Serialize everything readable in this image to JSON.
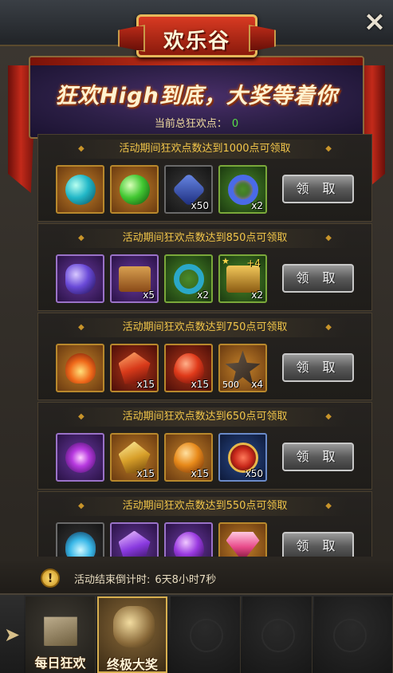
{
  "header": {
    "title": "欢乐谷",
    "close_icon": "×"
  },
  "banner": {
    "slogan": "狂欢High到底，大奖等着你",
    "points_label": "当前总狂欢点：",
    "points_value": "0"
  },
  "tiers": [
    {
      "requirement": "活动期间狂欢点数达到1000点可领取",
      "claim_label": "领 取",
      "rewards": [
        {
          "icon": "teal-orb-icon",
          "qty": ""
        },
        {
          "icon": "green-orb-icon",
          "qty": ""
        },
        {
          "icon": "sapphire-icon",
          "qty": "x50"
        },
        {
          "icon": "ring-icon",
          "qty": "x2"
        }
      ]
    },
    {
      "requirement": "活动期间狂欢点数达到850点可领取",
      "claim_label": "领 取",
      "rewards": [
        {
          "icon": "purple-stone-icon",
          "qty": ""
        },
        {
          "icon": "chest-icon",
          "qty": "x5"
        },
        {
          "icon": "teal-ring-icon",
          "qty": "x2"
        },
        {
          "icon": "gold-chest-icon",
          "qty": "x2",
          "plus": "+4"
        }
      ]
    },
    {
      "requirement": "活动期间狂欢点数达到750点可领取",
      "claim_label": "领 取",
      "rewards": [
        {
          "icon": "fire-brazier-icon",
          "qty": ""
        },
        {
          "icon": "red-crystal-icon",
          "qty": "x15"
        },
        {
          "icon": "ruby-icon",
          "qty": "x15"
        },
        {
          "icon": "star-emblem-icon",
          "qty": "x4",
          "amount": "500"
        }
      ]
    },
    {
      "requirement": "活动期间狂欢点数达到650点可领取",
      "claim_label": "领 取",
      "rewards": [
        {
          "icon": "vortex-icon",
          "qty": ""
        },
        {
          "icon": "gold-shard-icon",
          "qty": "x15"
        },
        {
          "icon": "amber-icon",
          "qty": "x15"
        },
        {
          "icon": "red-medallion-icon",
          "qty": "x50"
        }
      ]
    },
    {
      "requirement": "活动期间狂欢点数达到550点可领取",
      "claim_label": "领 取",
      "rewards": [
        {
          "icon": "blue-flame-icon",
          "qty": ""
        },
        {
          "icon": "violet-crystal-icon",
          "qty": ""
        },
        {
          "icon": "amethyst-icon",
          "qty": ""
        },
        {
          "icon": "pink-diamond-icon",
          "qty": ""
        }
      ]
    }
  ],
  "countdown": {
    "label": "活动结束倒计时:",
    "value": "6天8小时7秒"
  },
  "tabs": [
    {
      "label": "每日狂欢",
      "icon": "gift-box-icon",
      "active": false
    },
    {
      "label": "终极大奖",
      "icon": "gold-ore-icon",
      "active": true
    }
  ],
  "colors": {
    "requirement_text": "#f2c64a",
    "points_value": "#58e048",
    "title_red": "#d83a22"
  }
}
